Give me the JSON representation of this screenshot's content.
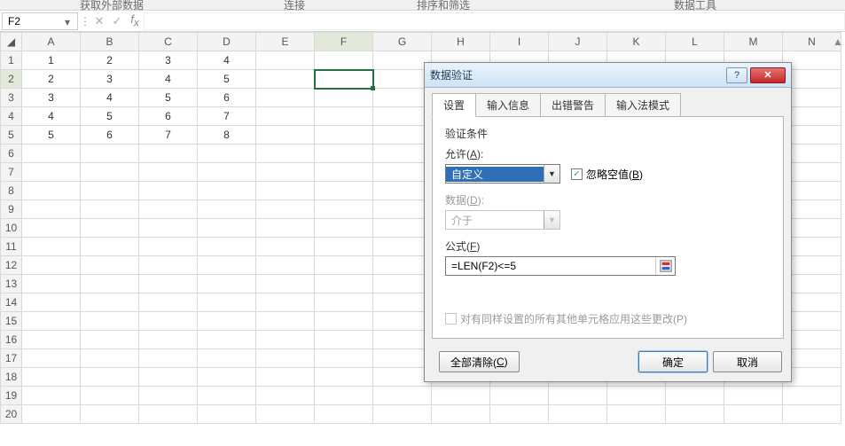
{
  "ribbon": {
    "group1": "获取外部数据",
    "group2": "连接",
    "group3": "排序和筛选",
    "group4": "数据工具"
  },
  "namebox": {
    "value": "F2"
  },
  "formula_bar": {
    "value": ""
  },
  "columns": [
    "A",
    "B",
    "C",
    "D",
    "E",
    "F",
    "G",
    "H",
    "I",
    "J",
    "K",
    "L",
    "M",
    "N"
  ],
  "rows": [
    "1",
    "2",
    "3",
    "4",
    "5",
    "6",
    "7",
    "8",
    "9",
    "10",
    "11",
    "12",
    "13",
    "14",
    "15",
    "16",
    "17",
    "18",
    "19",
    "20"
  ],
  "cells": {
    "r1": {
      "A": "1",
      "B": "2",
      "C": "3",
      "D": "4"
    },
    "r2": {
      "A": "2",
      "B": "3",
      "C": "4",
      "D": "5"
    },
    "r3": {
      "A": "3",
      "B": "4",
      "C": "5",
      "D": "6"
    },
    "r4": {
      "A": "4",
      "B": "5",
      "C": "6",
      "D": "7"
    },
    "r5": {
      "A": "5",
      "B": "6",
      "C": "7",
      "D": "8"
    }
  },
  "active_cell": "F2",
  "dialog": {
    "title": "数据验证",
    "tabs": {
      "settings": "设置",
      "input_msg": "输入信息",
      "error_alert": "出错警告",
      "ime_mode": "输入法模式"
    },
    "section_title": "验证条件",
    "allow_label": "允许(A):",
    "allow_value": "自定义",
    "ignore_blank": "忽略空值(B)",
    "data_label": "数据(D):",
    "data_value": "介于",
    "formula_label": "公式(F)",
    "formula_value": "=LEN(F2)<=5",
    "apply_all": "对有同样设置的所有其他单元格应用这些更改(P)",
    "clear_all": "全部清除(C)",
    "ok": "确定",
    "cancel": "取消"
  }
}
